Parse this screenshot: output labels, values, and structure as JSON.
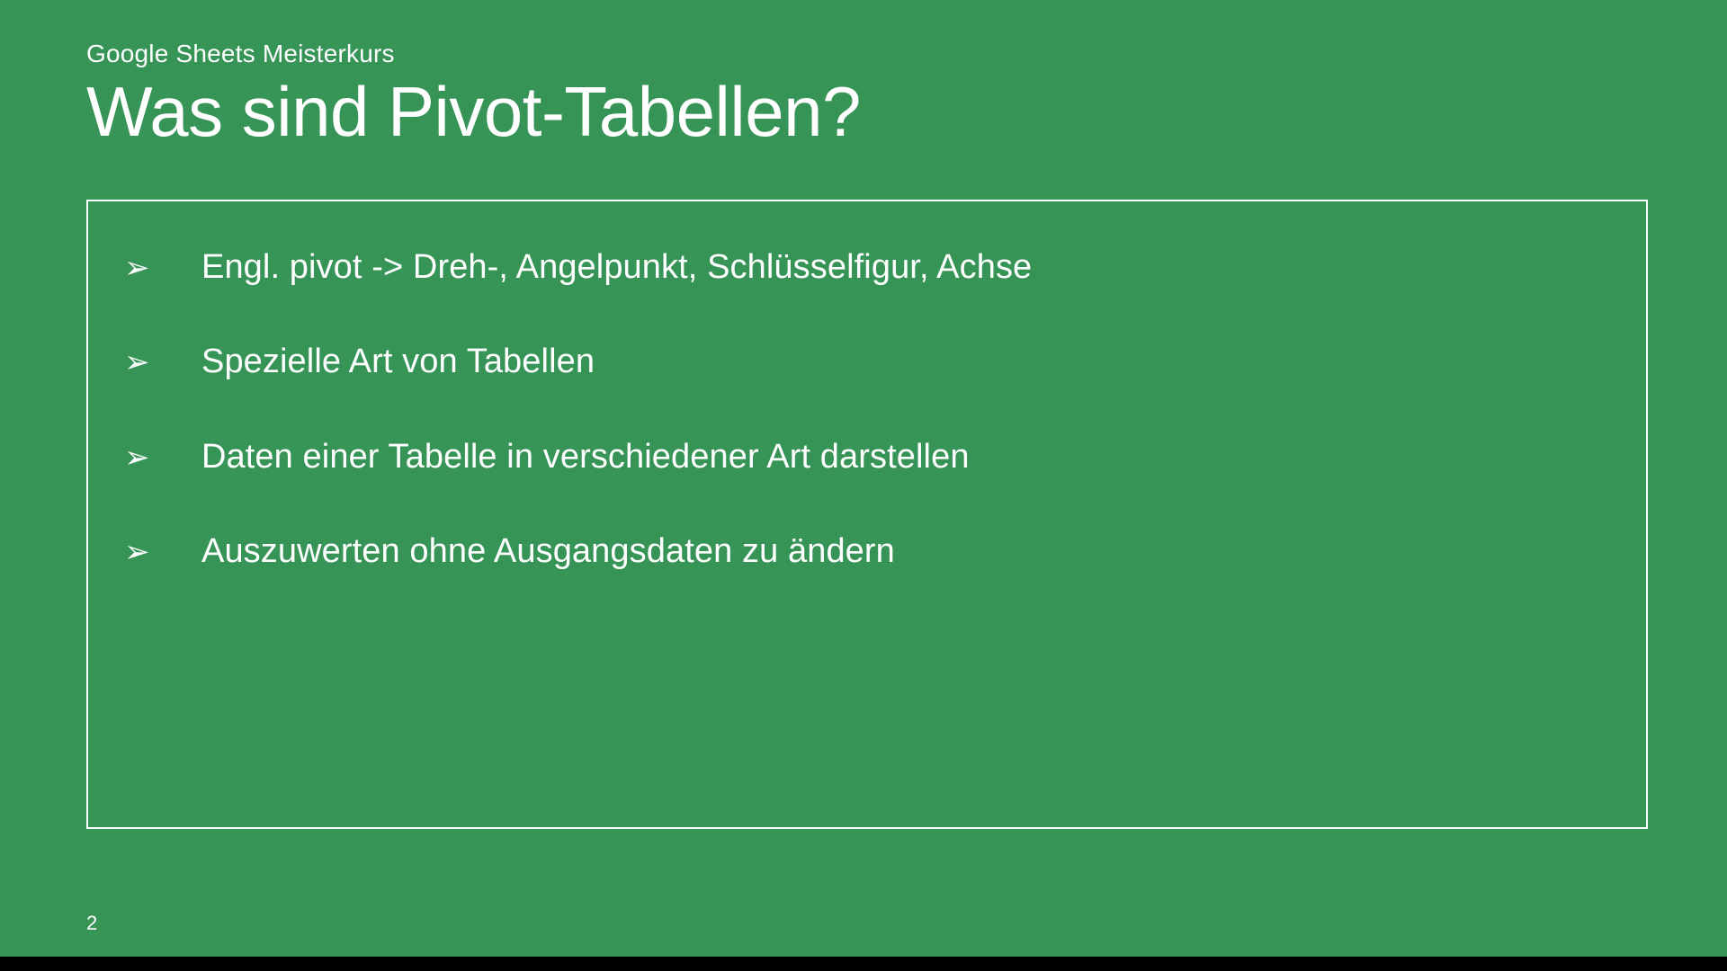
{
  "kicker": "Google Sheets Meisterkurs",
  "title": "Was sind Pivot-Tabellen?",
  "bullet_glyph": "➢",
  "bullets": [
    "Engl. pivot -> Dreh-, Angelpunkt, Schlüsselfigur, Achse",
    "Spezielle Art von Tabellen",
    "Daten einer Tabelle in verschiedener Art darstellen",
    "Auszuwerten ohne Ausgangsdaten zu ändern"
  ],
  "page_number": "2"
}
